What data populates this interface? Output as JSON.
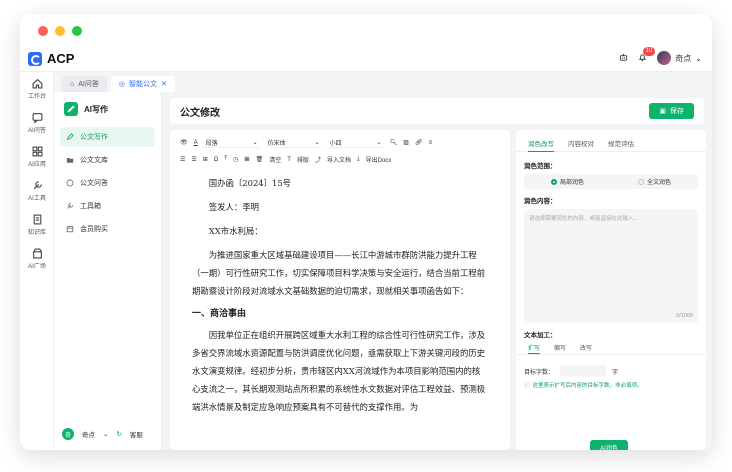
{
  "app": {
    "name": "ACP",
    "badge": "10",
    "username": "奇点"
  },
  "rail": [
    {
      "label": "工作台",
      "icon": "home-icon"
    },
    {
      "label": "AI问答",
      "icon": "chat-icon"
    },
    {
      "label": "AI应用",
      "icon": "apps-icon"
    },
    {
      "label": "AI工具",
      "icon": "tool-icon"
    },
    {
      "label": "知识库",
      "icon": "book-icon"
    },
    {
      "label": "AI广场",
      "icon": "store-icon"
    }
  ],
  "tabs": [
    {
      "label": "AI问答"
    },
    {
      "label": "智能公文"
    }
  ],
  "sidebar": {
    "title": "AI写作",
    "items": [
      {
        "label": "公文写作"
      },
      {
        "label": "公文文库"
      },
      {
        "label": "公文问答"
      },
      {
        "label": "工具箱"
      },
      {
        "label": "会员购买"
      }
    ],
    "footer_user": "奇点",
    "footer_share": "客服"
  },
  "page": {
    "title": "公文修改",
    "save_label": "保存"
  },
  "toolbar": {
    "paragraph": "段落",
    "font": "仿宋体",
    "size": "小四",
    "clear": "清空",
    "layout": "排版",
    "import": "导入文档",
    "export": "导出Docx"
  },
  "doc": {
    "line1": "国办函〔2024〕15号",
    "line2": "签发人：李明",
    "line3": "XX市水利局：",
    "para1": "为推进国家重大区域基础建设项目——长江中游城市群防洪能力提升工程（一期）可行性研究工作，切实保障项目科学决策与安全运行，结合当前工程前期勘察设计阶段对流域水文基础数据的迫切需求，现就相关事项函告如下：",
    "heading1": "一、商洽事由",
    "para2": "因我单位正在组织开展跨区域重大水利工程的综合性可行性研究工作，涉及多省交界流域水资源配置与防洪调度优化问题，亟需获取上下游关键河段的历史水文演变规律。经初步分析，贵市辖区内XX河流域作为本项目影响范围内的核心支流之一，其长期观测站点所积累的系统性水文数据对评估工程效益、预测极端洪水情景及制定应急响应预案具有不可替代的支撑作用。为"
  },
  "right": {
    "tabs": [
      "润色改写",
      "内容校对",
      "规范评估"
    ],
    "scope_label": "润色范围：",
    "scope_opts": [
      "局部润色",
      "全文润色"
    ],
    "content_label": "润色内容：",
    "placeholder": "请选择需要润色的内容，或者直接在此输入...",
    "counter": "0/1000",
    "process_label": "文本加工：",
    "sub_tabs": [
      "扩写",
      "缩写",
      "改写"
    ],
    "target_label": "目标字数：",
    "target_unit": "字",
    "hint": "这里表示扩写后内容的目标字数，非必填项。",
    "ai_btn": "AI润色"
  }
}
